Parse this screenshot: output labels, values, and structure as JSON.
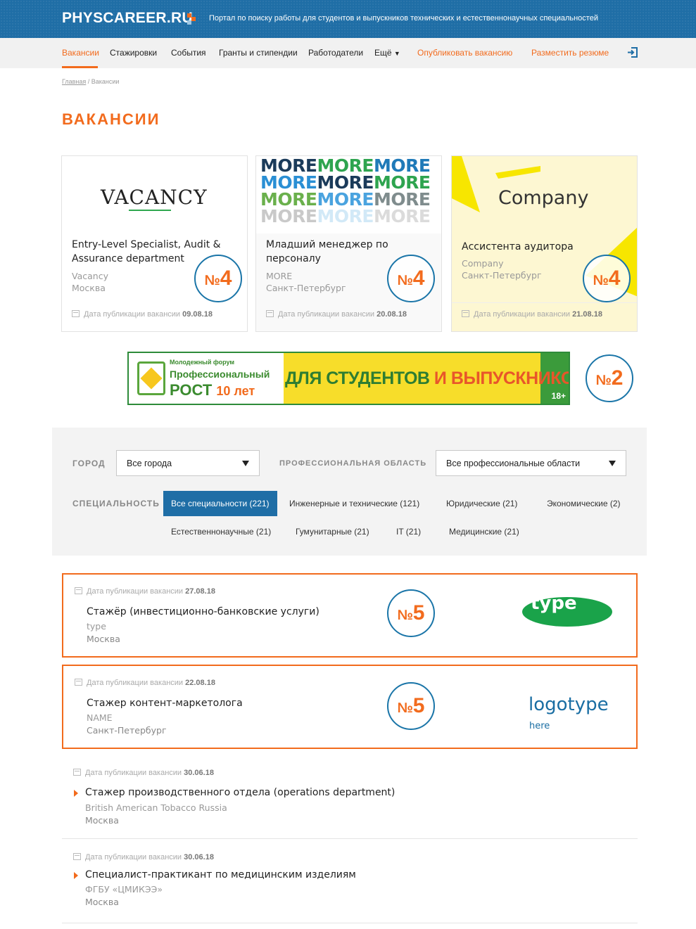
{
  "header": {
    "logo": "PHYSCAREER.RU",
    "tagline": "Портал по поиску работы для студентов и выпускников технических и естественнонаучных специальностей"
  },
  "nav": {
    "items": [
      "Вакансии",
      "Стажировки",
      "События",
      "Гранты и стипендии",
      "Работодатели",
      "Ещё"
    ],
    "publish_vacancy": "Опубликовать вакансию",
    "post_resume": "Разместить резюме"
  },
  "breadcrumb": {
    "home": "Главная",
    "separator": " / ",
    "current": "Вакансии"
  },
  "page_title": "ВАКАНСИИ",
  "badges": {
    "card": "4",
    "banner": "2",
    "listing": "5",
    "prefix": "№"
  },
  "cards": [
    {
      "logo_text": "VACANCY",
      "title": "Entry-Level Specialist, Audit & Assurance department",
      "company": "Vacancy",
      "city": "Москва",
      "date_label": "Дата публикации вакансии",
      "date": "09.08.18"
    },
    {
      "logo_text": "MOREMOREMORE",
      "title": "Младший менеджер по персоналу",
      "company": "MORE",
      "city": "Санкт-Петербург",
      "date_label": "Дата публикации вакансии",
      "date": "20.08.18"
    },
    {
      "logo_text": "Company",
      "title": "Ассистента аудитора",
      "company": "Company",
      "city": "Санкт-Петербург",
      "date_label": "Дата публикации вакансии",
      "date": "21.08.18"
    }
  ],
  "banner": {
    "line1": "Молодежный форум",
    "line2": "Профессиональный",
    "line3": "РОСТ",
    "years": "10 лет",
    "main_a": "ДЛЯ СТУДЕНТОВ",
    "main_b": " И ВЫПУСКНИКОВ ВУЗОВ",
    "age": "18+"
  },
  "filters": {
    "city_label": "ГОРОД",
    "city_value": "Все города",
    "area_label": "ПРОФЕССИОНАЛЬНАЯ ОБЛАСТЬ",
    "area_value": "Все профессиональные области",
    "spec_label": "СПЕЦИАЛЬНОСТЬ",
    "chips": [
      "Все специальности (221)",
      "Инженерные и технические (121)",
      "Юридические (21)",
      "Экономические (2)",
      "Естественнонаучные (21)",
      "Гумунитарные (21)",
      "IT (21)",
      "Медицинские (21)"
    ]
  },
  "listings": [
    {
      "date_label": "Дата публикации вакансии",
      "date": "27.08.18",
      "title": "Стажёр (инвестиционно-банковские услуги)",
      "company": "type",
      "city": "Москва",
      "logo": "type"
    },
    {
      "date_label": "Дата публикации вакансии",
      "date": "22.08.18",
      "title": "Стажер контент-маркетолога",
      "company": "NAME",
      "city": "Санкт-Петербург",
      "logo": "logotype",
      "logo_sub": "here"
    },
    {
      "date_label": "Дата публикации вакансии",
      "date": "30.06.18",
      "title": "Стажер производственного отдела (operations department)",
      "company": "British American Tobacco Russia",
      "city": "Москва"
    },
    {
      "date_label": "Дата публикации вакансии",
      "date": "30.06.18",
      "title": "Специалист-практикант по медицинским изделиям",
      "company": "ФГБУ «ЦМИКЭЭ»",
      "city": "Москва"
    }
  ],
  "colors": {
    "brand_blue": "#1f6ea6",
    "accent_orange": "#f26b1d",
    "banner_green": "#2e8b3a"
  }
}
